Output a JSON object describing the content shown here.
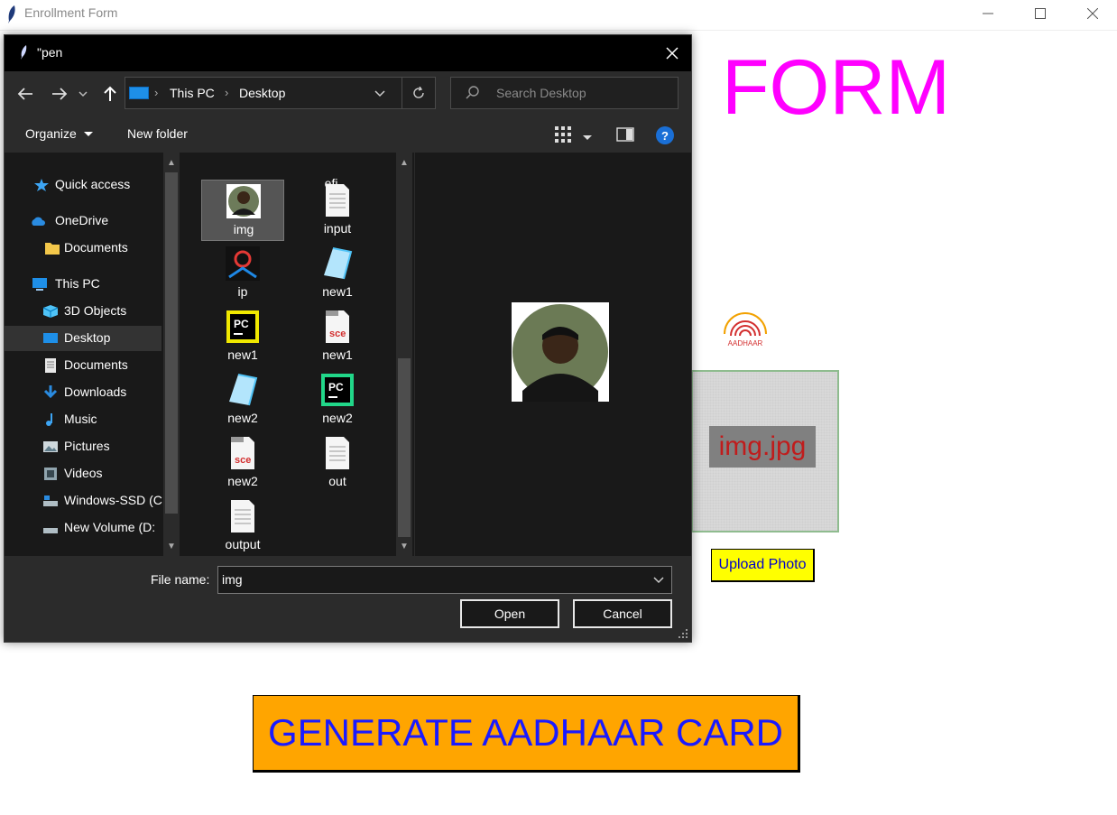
{
  "window": {
    "title": "Enrollment Form",
    "controls": [
      "minimize",
      "maximize",
      "close"
    ]
  },
  "form": {
    "heading_visible": "FORM",
    "heading_color": "#ff00ff",
    "logo_text": "AADHAAR",
    "photo_label": "img.jpg",
    "upload_button": "Upload Photo",
    "generate_button": "GENERATE AADHAAR CARD"
  },
  "dialog": {
    "title": "\"pen",
    "address": {
      "crumbs": [
        "This PC",
        "Desktop"
      ]
    },
    "search_placeholder": "Search Desktop",
    "toolbar": {
      "organize": "Organize",
      "new_folder": "New folder",
      "help": "?"
    },
    "nav_items": [
      {
        "label": "Quick access",
        "icon": "star-icon"
      },
      {
        "label": "OneDrive",
        "icon": "cloud-icon"
      },
      {
        "label": "Documents",
        "icon": "folder-icon"
      },
      {
        "label": "This PC",
        "icon": "computer-icon"
      },
      {
        "label": "3D Objects",
        "icon": "cube-icon"
      },
      {
        "label": "Desktop",
        "icon": "desktop-icon",
        "selected": true
      },
      {
        "label": "Documents",
        "icon": "document-icon"
      },
      {
        "label": "Downloads",
        "icon": "download-icon"
      },
      {
        "label": "Music",
        "icon": "music-icon"
      },
      {
        "label": "Pictures",
        "icon": "pictures-icon"
      },
      {
        "label": "Videos",
        "icon": "video-icon"
      },
      {
        "label": "Windows-SSD (C",
        "icon": "drive-icon"
      },
      {
        "label": "New Volume (D:",
        "icon": "drive-icon"
      }
    ],
    "files": [
      {
        "label": "efi.",
        "icon": "file-icon"
      },
      {
        "label": "img",
        "icon": "photo-icon",
        "selected": true
      },
      {
        "label": "input",
        "icon": "file-icon"
      },
      {
        "label": "ip",
        "icon": "map-pin-icon"
      },
      {
        "label": "new1",
        "icon": "notepad-icon"
      },
      {
        "label": "new1",
        "icon": "pycharm-icon"
      },
      {
        "label": "new1",
        "icon": "sce-file-icon"
      },
      {
        "label": "new2",
        "icon": "notepad-icon"
      },
      {
        "label": "new2",
        "icon": "pycharm-icon"
      },
      {
        "label": "new2",
        "icon": "sce-file-icon"
      },
      {
        "label": "out",
        "icon": "file-icon"
      },
      {
        "label": "output",
        "icon": "file-icon"
      }
    ],
    "file_name_label": "File name:",
    "file_name_value": "img",
    "open_button": "Open",
    "cancel_button": "Cancel"
  }
}
